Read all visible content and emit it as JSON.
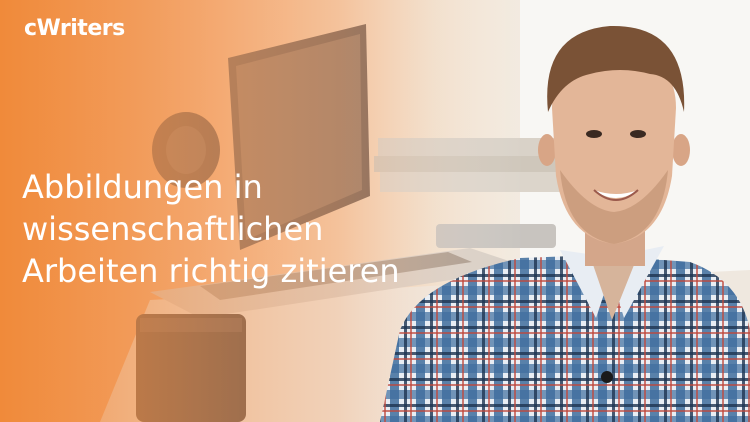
{
  "brand": {
    "logo_text": "cWriters"
  },
  "headline": {
    "lines": [
      "Abbildungen in",
      "wissenschaftlichen",
      "Arbeiten richtig zitieren"
    ]
  },
  "colors": {
    "overlay_orange": "#f08a3a",
    "text": "#ffffff"
  },
  "photo": {
    "subject": "presenter-portrait",
    "background": "desk-with-laptop"
  }
}
